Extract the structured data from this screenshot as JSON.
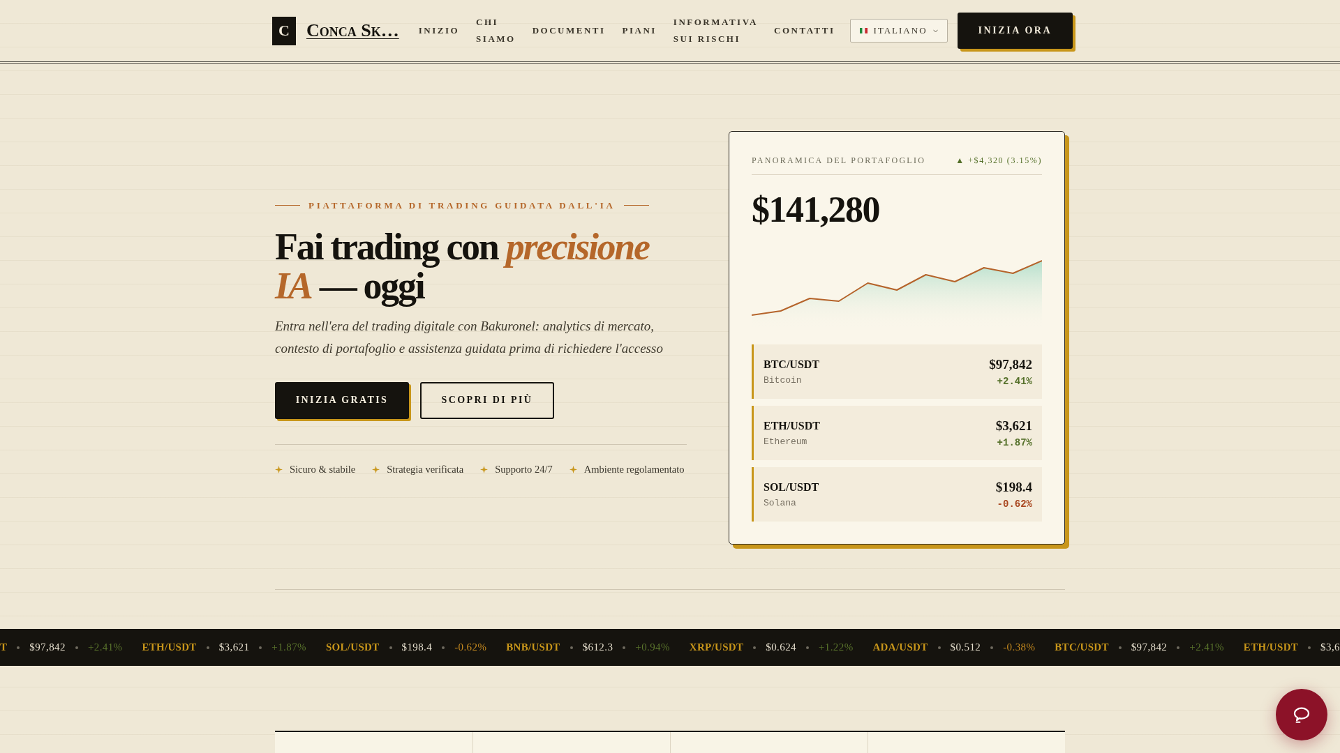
{
  "header": {
    "logo": {
      "mark": "C",
      "name": "Conca Sk…"
    },
    "nav": [
      {
        "label": "INIZIO"
      },
      {
        "label": "CHI SIAMO"
      },
      {
        "label": "DOCUMENTI"
      },
      {
        "label": "PIANI"
      },
      {
        "label": "INFORMATIVA SUI RISCHI"
      },
      {
        "label": "CONTATTI"
      }
    ],
    "language": "ITALIANO",
    "cta": "INIZIA ORA"
  },
  "hero": {
    "eyebrow": "PIATTAFORMA DI TRADING GUIDATA DALL'IA",
    "headline": "Fai trading con *precisione IA* — oggi",
    "subtitle": "Entra nell'era del trading digitale con Bakuronel: analytics di mercato, contesto di portafoglio e assistenza guidata prima di richiedere l'accesso",
    "buttons": [
      {
        "label": "INIZIA GRATIS",
        "kind": "primary"
      },
      {
        "label": "SCOPRI DI PIÙ",
        "kind": "outline"
      }
    ],
    "features": [
      {
        "label": "Sicuro & stabile"
      },
      {
        "label": "Strategia verificata"
      },
      {
        "label": "Supporto 24/7"
      },
      {
        "label": "Ambiente regolamentato"
      }
    ]
  },
  "portfolio": {
    "title": "PANORAMICA DEL PORTAFOGLIO",
    "change": "▲ +$4,320 (3.15%)",
    "positive": true,
    "total": "$141,280",
    "assets": [
      {
        "pair": "BTC/USDT",
        "name": "Bitcoin",
        "price": "$97,842",
        "change": "+2.41%",
        "positive": true
      },
      {
        "pair": "ETH/USDT",
        "name": "Ethereum",
        "price": "$3,621",
        "change": "+1.87%",
        "positive": true
      },
      {
        "pair": "SOL/USDT",
        "name": "Solana",
        "price": "$198.4",
        "change": "-0.62%",
        "positive": false
      }
    ]
  },
  "ticker": [
    {
      "pair": "T",
      "price": "$97,842",
      "change": "+2.41%",
      "positive": true
    },
    {
      "pair": "ETH/USDT",
      "price": "$3,621",
      "change": "+1.87%",
      "positive": true
    },
    {
      "pair": "SOL/USDT",
      "price": "$198.4",
      "change": "-0.62%",
      "positive": false
    },
    {
      "pair": "BNB/USDT",
      "price": "$612.3",
      "change": "+0.94%",
      "positive": true
    },
    {
      "pair": "XRP/USDT",
      "price": "$0.624",
      "change": "+1.22%",
      "positive": true
    },
    {
      "pair": "ADA/USDT",
      "price": "$0.512",
      "change": "-0.38%",
      "positive": false
    },
    {
      "pair": "BTC/USDT",
      "price": "$97,842",
      "change": "+2.41%",
      "positive": true
    },
    {
      "pair": "ETH/USDT",
      "price": "$3,6"
    }
  ]
}
